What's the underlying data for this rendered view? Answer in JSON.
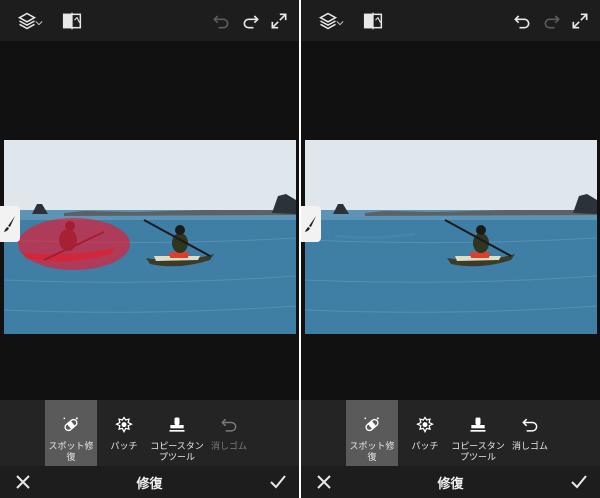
{
  "colors": {
    "panel_bg": "#191919",
    "canvas_bg": "#111111",
    "toolbar_bg": "#242424",
    "selected_tool_bg": "#5a5a5a",
    "spot_mask": "#e0203a",
    "sky": "#dfe7ec",
    "sea": "#3f7ea5"
  },
  "panels": [
    {
      "id": "before",
      "topbar": {
        "icons": [
          "layers-icon",
          "compare-icon",
          "undo-icon",
          "redo-icon",
          "expand-icon"
        ],
        "undo_enabled": false,
        "redo_enabled": true
      },
      "photo": {
        "spot_mask_visible": true,
        "left_kayak_visible": true
      },
      "tools": [
        {
          "label": "スポット修復",
          "icon": "spot-heal-icon",
          "selected": true,
          "enabled": true
        },
        {
          "label": "パッチ",
          "icon": "patch-icon",
          "selected": false,
          "enabled": true
        },
        {
          "label": "コピースタンプツール",
          "label_line1": "コピースタン",
          "label_line2": "プツール",
          "icon": "clone-stamp-icon",
          "selected": false,
          "enabled": true
        },
        {
          "label": "消しゴム",
          "icon": "eraser-icon",
          "selected": false,
          "enabled": false
        }
      ],
      "bottombar": {
        "title": "修復",
        "close_icon": "close-icon",
        "confirm_icon": "checkmark-icon"
      }
    },
    {
      "id": "after",
      "topbar": {
        "icons": [
          "layers-icon",
          "compare-icon",
          "undo-icon",
          "redo-icon",
          "expand-icon"
        ],
        "undo_enabled": true,
        "redo_enabled": false
      },
      "photo": {
        "spot_mask_visible": false,
        "left_kayak_visible": false
      },
      "tools": [
        {
          "label": "スポット修復",
          "icon": "spot-heal-icon",
          "selected": true,
          "enabled": true
        },
        {
          "label": "パッチ",
          "icon": "patch-icon",
          "selected": false,
          "enabled": true
        },
        {
          "label": "コピースタンプツール",
          "label_line1": "コピースタン",
          "label_line2": "プツール",
          "icon": "clone-stamp-icon",
          "selected": false,
          "enabled": true
        },
        {
          "label": "消しゴム",
          "icon": "eraser-icon",
          "selected": false,
          "enabled": true
        }
      ],
      "bottombar": {
        "title": "修復",
        "close_icon": "close-icon",
        "confirm_icon": "checkmark-icon"
      }
    }
  ]
}
